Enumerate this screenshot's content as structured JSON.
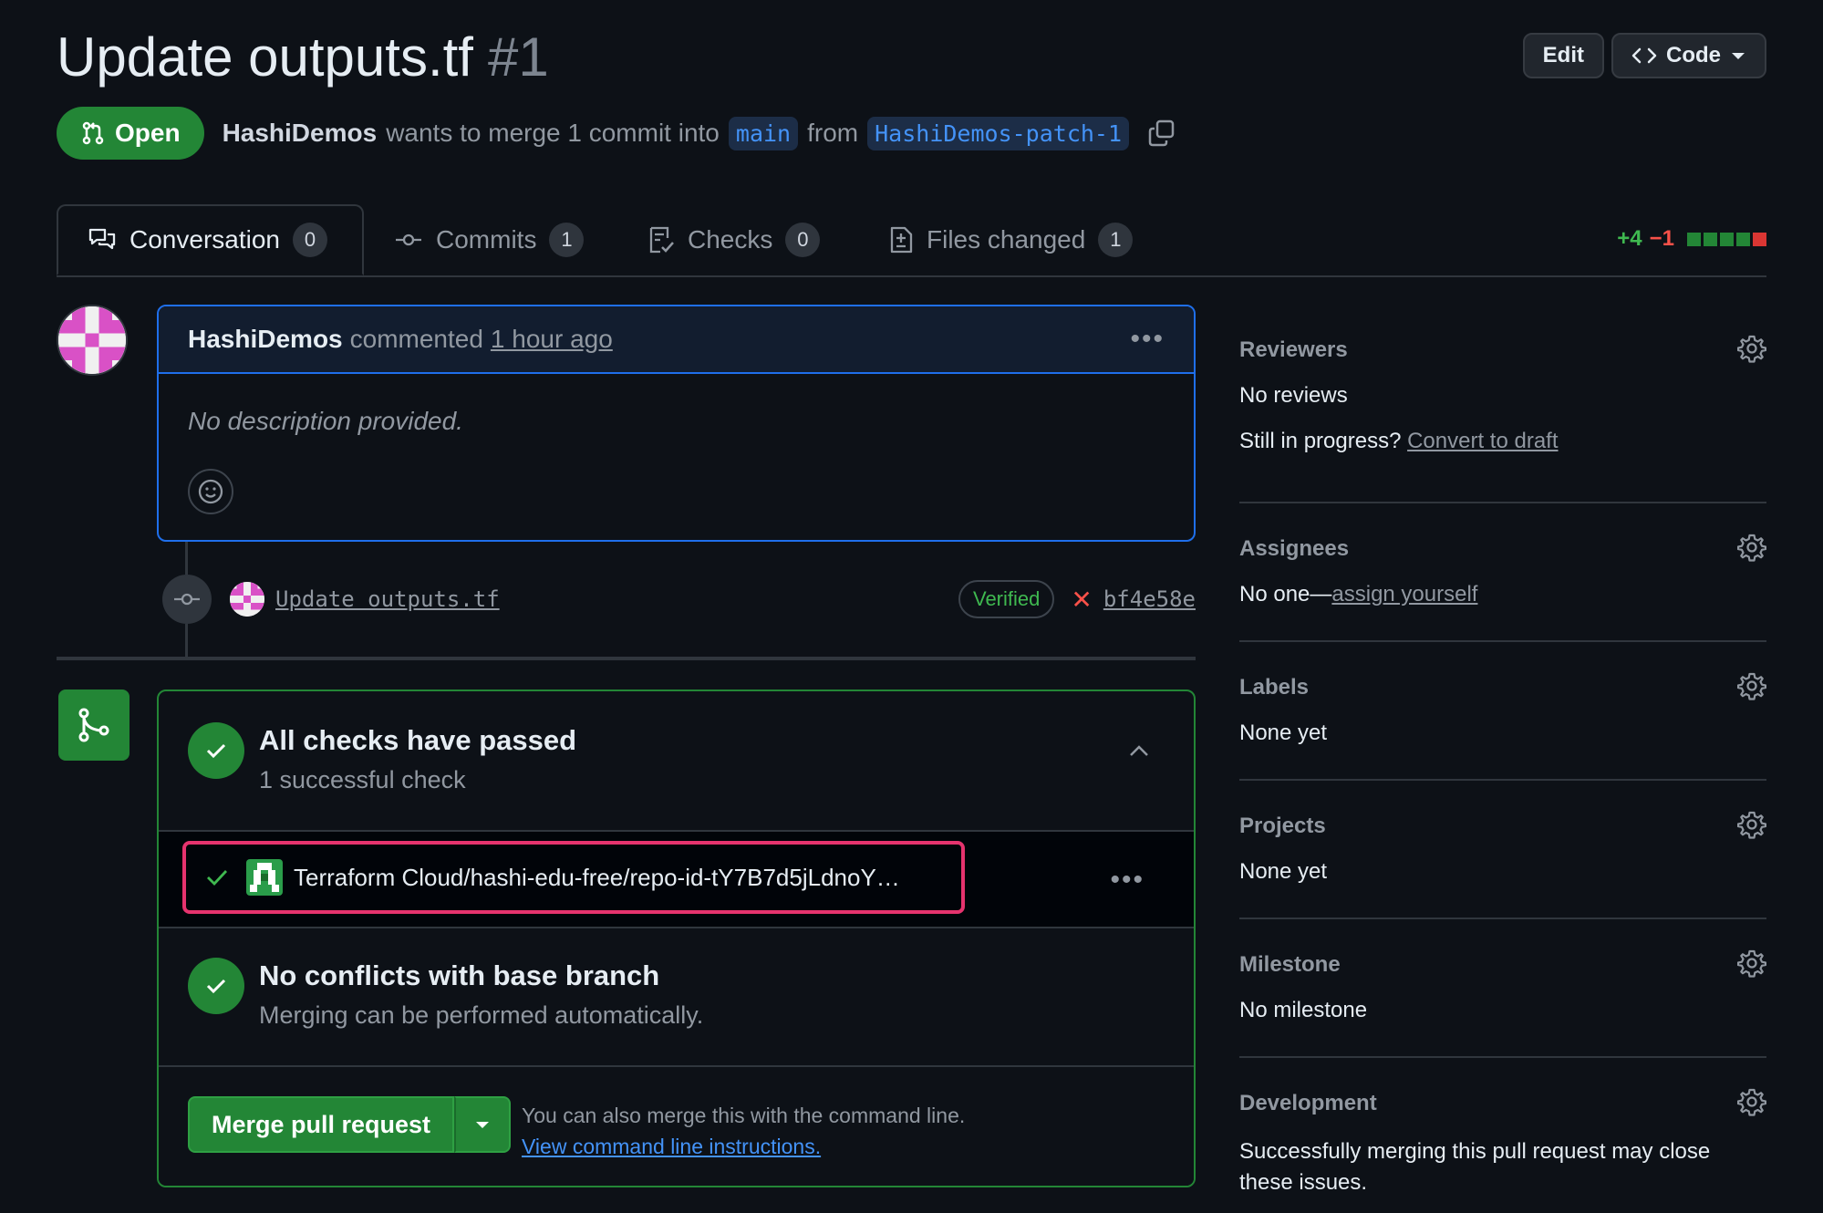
{
  "header": {
    "title": "Update outputs.tf",
    "pr_number": "#1",
    "edit_label": "Edit",
    "code_label": "Code"
  },
  "status": {
    "state_label": "Open",
    "author": "HashiDemos",
    "merge_text": "wants to merge 1 commit into",
    "base_branch": "main",
    "from_text": "from",
    "head_branch": "HashiDemos-patch-1"
  },
  "tabs": [
    {
      "label": "Conversation",
      "count": "0"
    },
    {
      "label": "Commits",
      "count": "1"
    },
    {
      "label": "Checks",
      "count": "0"
    },
    {
      "label": "Files changed",
      "count": "1"
    }
  ],
  "diffstat": {
    "additions": "+4",
    "deletions": "−1"
  },
  "comment": {
    "author": "HashiDemos",
    "action": "commented",
    "time": "1 hour ago",
    "body": "No description provided."
  },
  "commit": {
    "message": "Update outputs.tf",
    "verified_label": "Verified",
    "sha": "bf4e58e"
  },
  "checks": {
    "title": "All checks have passed",
    "subtitle": "1 successful check",
    "check_name": "Terraform Cloud/hashi-edu-free/repo-id-tY7B7d5jLdnoY…"
  },
  "conflicts": {
    "title": "No conflicts with base branch",
    "subtitle": "Merging can be performed automatically."
  },
  "merge": {
    "button_label": "Merge pull request",
    "cli_text": "You can also merge this with the command line.",
    "cli_link": "View command line instructions."
  },
  "sidebar": {
    "reviewers": {
      "heading": "Reviewers",
      "value": "No reviews",
      "draft_prefix": "Still in progress?",
      "draft_link": "Convert to draft"
    },
    "assignees": {
      "heading": "Assignees",
      "value_prefix": "No one—",
      "assign_link": "assign yourself"
    },
    "labels": {
      "heading": "Labels",
      "value": "None yet"
    },
    "projects": {
      "heading": "Projects",
      "value": "None yet"
    },
    "milestone": {
      "heading": "Milestone",
      "value": "No milestone"
    },
    "development": {
      "heading": "Development",
      "value": "Successfully merging this pull request may close these issues."
    }
  },
  "colors": {
    "accent": "#1f6feb",
    "success": "#238636",
    "danger": "#f85149",
    "highlight": "#e6336e"
  }
}
